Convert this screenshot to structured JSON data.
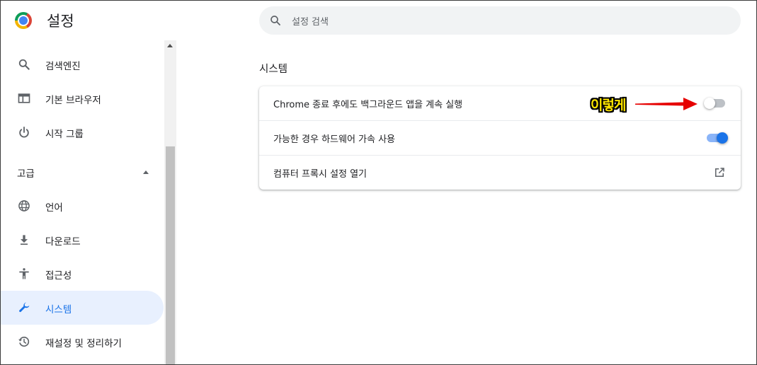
{
  "header": {
    "app_title": "설정",
    "search_placeholder": "설정 검색",
    "logo_icon": "chrome-logo-icon"
  },
  "sidebar": {
    "items": [
      {
        "label": "검색엔진",
        "icon": "search-icon"
      },
      {
        "label": "기본 브라우저",
        "icon": "browser-window-icon"
      },
      {
        "label": "시작 그룹",
        "icon": "power-icon"
      }
    ],
    "advanced_title": "고급",
    "advanced_items": [
      {
        "label": "언어",
        "icon": "globe-icon"
      },
      {
        "label": "다운로드",
        "icon": "download-icon"
      },
      {
        "label": "접근성",
        "icon": "accessibility-icon"
      },
      {
        "label": "시스템",
        "icon": "wrench-icon",
        "active": true
      },
      {
        "label": "재설정 및 정리하기",
        "icon": "restore-icon"
      }
    ]
  },
  "main": {
    "section_title": "시스템",
    "rows": [
      {
        "label": "Chrome 종료 후에도 백그라운드 앱을 계속 실행",
        "control": "toggle",
        "checked": false
      },
      {
        "label": "가능한 경우 하드웨어 가속 사용",
        "control": "toggle",
        "checked": true
      },
      {
        "label": "컴퓨터 프록시 설정 열기",
        "control": "external-link-icon"
      }
    ]
  },
  "annotation": {
    "text": "이렇게",
    "text_color": "#ffe600",
    "arrow_color": "#e60000"
  },
  "colors": {
    "accent": "#1a73e8",
    "active_bg": "#e8f0fe",
    "search_bg": "#f1f3f4"
  }
}
